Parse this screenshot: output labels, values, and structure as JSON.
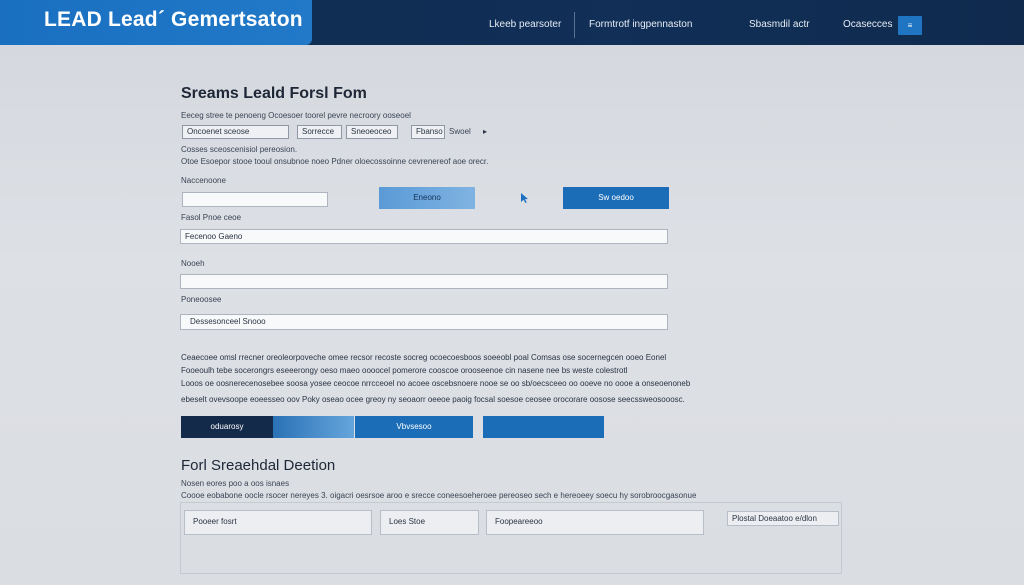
{
  "header": {
    "logo": "LEAD Lead´ Gemertsaton",
    "nav": [
      "Lkeeb pearsoter",
      "Formtrotf ingpennaston",
      "Sbasmdil actr",
      "Ocasecces"
    ],
    "nav_button": "≡"
  },
  "form": {
    "title": "Sreams Leald Forsl Fom",
    "intro": "Eeceg stree te penoeng Ocoesoer toorel pevre necroory ooseoel",
    "chips": [
      "Oncoenet sceose",
      "Sorrecce",
      "Sneoeoceo",
      "Fbanso",
      "Swoel"
    ],
    "sub1": "Cosses sceoscenisiol pereosion.",
    "sub2": "Otoe Esoepor stooe tooul onsubnoe noeo Pdner oloecossoinne cevrenereof aoe orecr.",
    "field1_label": "Naccenoone",
    "button_a": "Eneono",
    "button_b": "Sw oedoo",
    "field2_label": "Fasol Pnoe ceoe",
    "field2_value": "Fecenoo Gaeno",
    "field3_label": "Nooeh",
    "field4_label": "Poneoosee",
    "field4_value": "Dessesonceel Snooo",
    "paragraph": [
      "Ceaecoee omsl rrecner oreoleorpoveche omee recsor recoste socreg ocoecoesboos soeeobl poal Comsas ose socernegcen ooeo Eonel",
      "Fooeoulh tebe socerongrs eseeerongy oeso maeo oooocel pomerore cooscoe orooseenoe cin nasene nee bs weste colestrotl",
      "Looos oe oosnerecenosebee soosa yosee ceocoe nrrcceoel no acoee oscebsnoere nooe se oo sb/oecsceeo oo ooeve no oooe a onseoenoneb",
      "ebeselt ovevsoope eoeesseo oov Poky oseao ocee greoy ny seoaorr oeeoe paoig focsal soesoe ceosee orocorare oosose seecssweosooosc."
    ],
    "action_dark": "oduarosy",
    "action_mid": "Vbvsesoo"
  },
  "section2": {
    "title": "Forl Sreaehdal Deetion",
    "sub1": "Nosen eores poo a oos isnaes",
    "sub2": "Coooe eobabone oocle rsocer nereyes 3. oigacri oesrsoe aroo e srecce coneesoeheroee pereoseo sech e hereoeey soecu hy sorobroocgasonue",
    "boxes": [
      "Pooeer fosrt",
      "Loes Stoe",
      "Foopeareeoo"
    ],
    "side_label": "Plostal Doeaatoo e/dlon"
  }
}
